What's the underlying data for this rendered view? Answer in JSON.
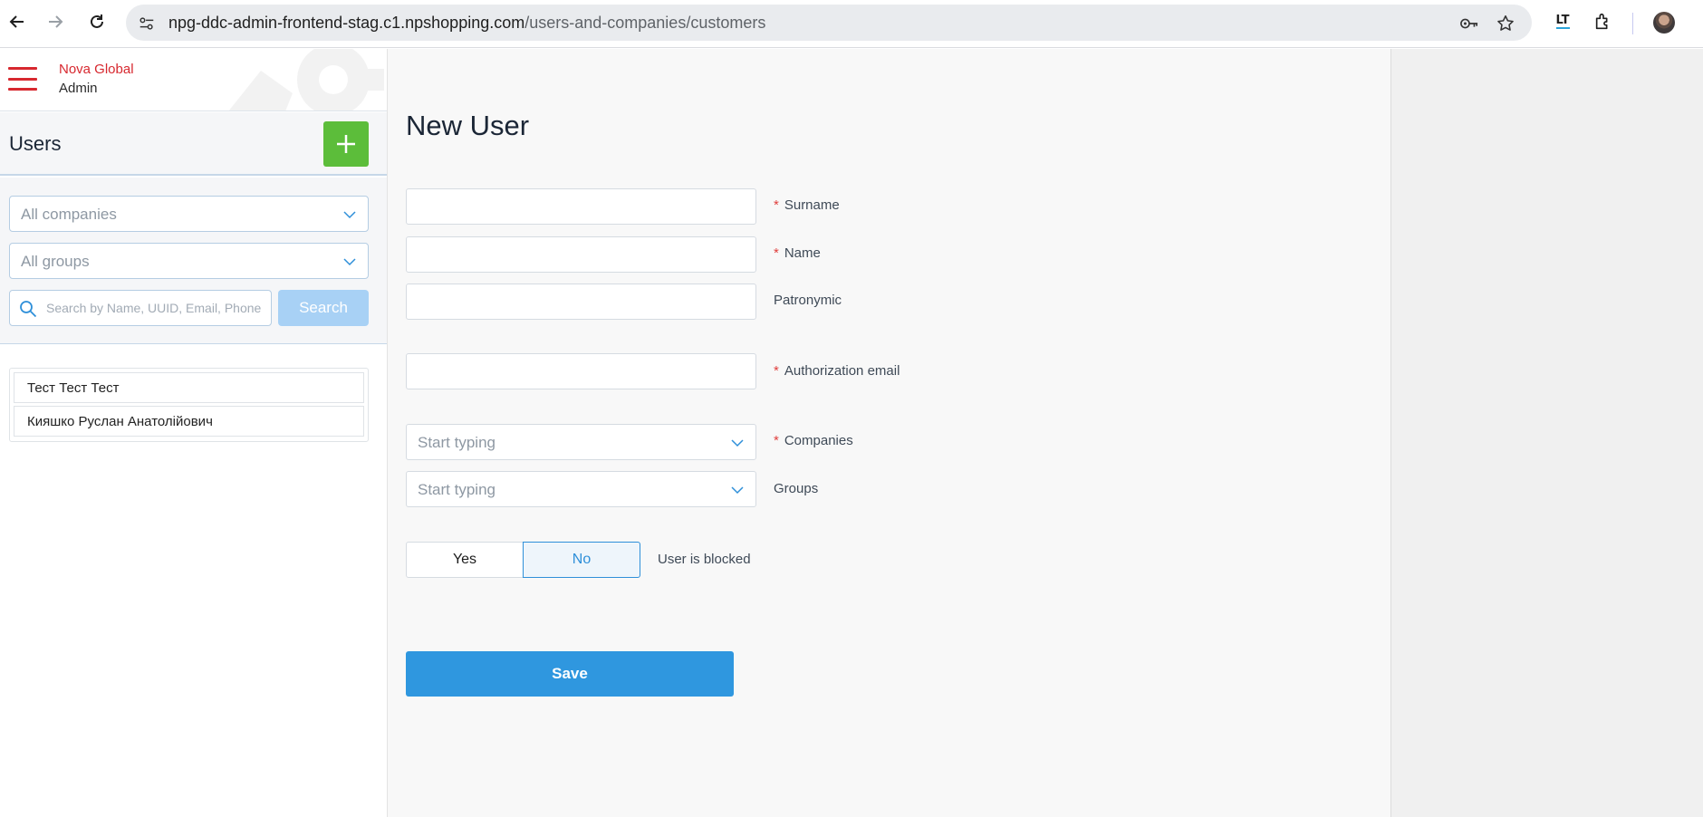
{
  "browser": {
    "url_domain": "npg-ddc-admin-frontend-stag.c1.npshopping.com",
    "url_path": "/users-and-companies/customers",
    "icons": [
      "back-icon",
      "forward-icon",
      "reload-icon",
      "site-info-icon",
      "password-key-icon",
      "bookmark-star-icon",
      "languagetool-extension-icon",
      "extensions-puzzle-icon",
      "profile-avatar"
    ],
    "extension_label": "LT"
  },
  "sidebar": {
    "brand": {
      "name": "Nova Global",
      "subtitle": "Admin"
    },
    "title": "Users",
    "filters": {
      "companies_placeholder": "All companies",
      "groups_placeholder": "All groups",
      "search_placeholder": "Search by Name, UUID, Email, Phone",
      "search_button": "Search"
    },
    "users": [
      {
        "name": "Тест Тест Тест"
      },
      {
        "name": "Кияшко Руслан Анатолійович"
      }
    ]
  },
  "form": {
    "title": "New User",
    "surname_label": "Surname",
    "name_label": "Name",
    "patronymic_label": "Patronymic",
    "email_label": "Authorization email",
    "companies_label": "Companies",
    "companies_placeholder": "Start typing",
    "groups_label": "Groups",
    "groups_placeholder": "Start typing",
    "required_mark": "*",
    "blocked": {
      "yes": "Yes",
      "no": "No",
      "selected": "No",
      "label": "User is blocked"
    },
    "save_label": "Save"
  },
  "colors": {
    "brand_red": "#d7282f",
    "add_green": "#5cbd3a",
    "primary_blue": "#2f97df",
    "search_disabled_blue": "#a8d1f5"
  }
}
